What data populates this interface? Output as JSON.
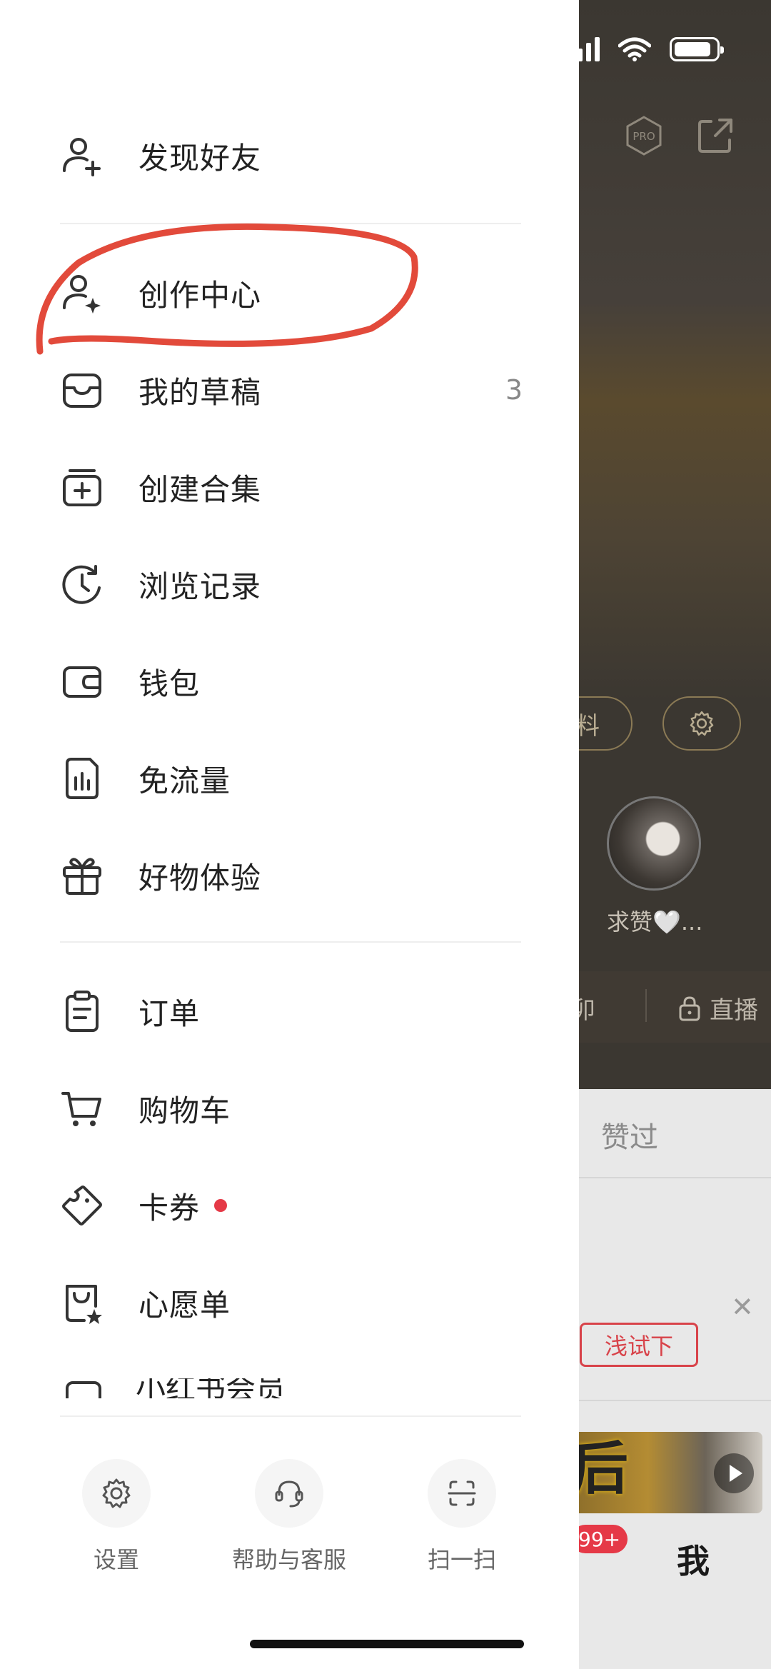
{
  "menu": {
    "discover_friends": "发现好友",
    "creator_center": "创作中心",
    "my_drafts": "我的草稿",
    "drafts_count": "3",
    "create_collection": "创建合集",
    "browse_history": "浏览记录",
    "wallet": "钱包",
    "free_data": "免流量",
    "product_trial": "好物体验",
    "orders": "订单",
    "cart": "购物车",
    "coupons": "卡券",
    "wishlist": "心愿单",
    "membership": "小红书会员"
  },
  "bottom_tools": {
    "settings": "设置",
    "help": "帮助与客服",
    "scan": "扫一扫"
  },
  "background": {
    "pill_left": "料",
    "avatar_label": "求赞🤍...",
    "tab_left": "卯",
    "tab_live": "直播",
    "sheet_tab": "赞过",
    "try_button": "浅试下",
    "video_char": "后",
    "badge": "99+",
    "me_tab": "我",
    "pro_badge": "PRO"
  },
  "colors": {
    "accent_red": "#e53947",
    "annotation_red": "#e24a3b",
    "text_primary": "#222222",
    "text_secondary": "#666666"
  },
  "status": {
    "battery_percent": 90
  }
}
